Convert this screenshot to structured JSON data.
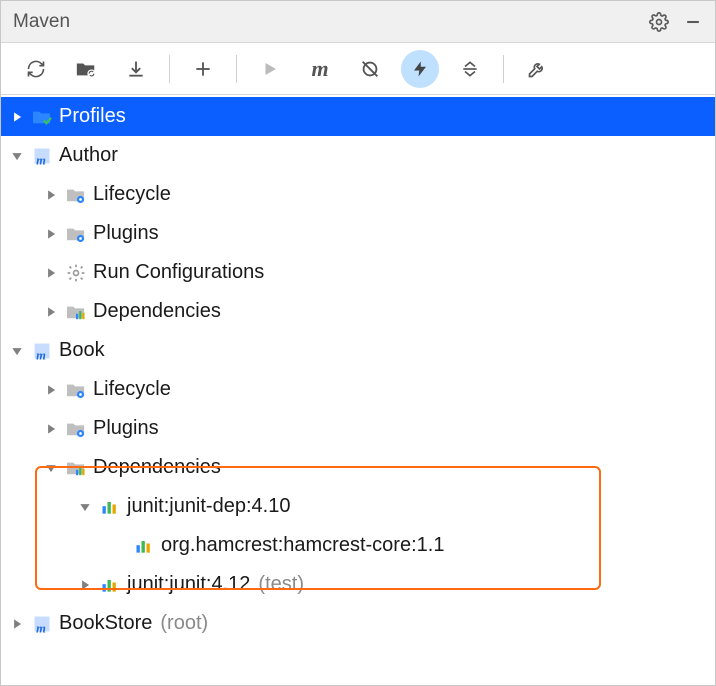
{
  "header": {
    "title": "Maven"
  },
  "tree": {
    "profiles": "Profiles",
    "author": "Author",
    "author_lifecycle": "Lifecycle",
    "author_plugins": "Plugins",
    "author_runconfig": "Run Configurations",
    "author_deps": "Dependencies",
    "book": "Book",
    "book_lifecycle": "Lifecycle",
    "book_plugins": "Plugins",
    "book_deps": "Dependencies",
    "book_dep_junitdep": "junit:junit-dep:4.10",
    "book_dep_hamcrest": "org.hamcrest:hamcrest-core:1.1",
    "book_dep_junit": "junit:junit:4.12",
    "book_dep_junit_scope": "(test)",
    "bookstore": "BookStore",
    "bookstore_suffix": "(root)"
  }
}
